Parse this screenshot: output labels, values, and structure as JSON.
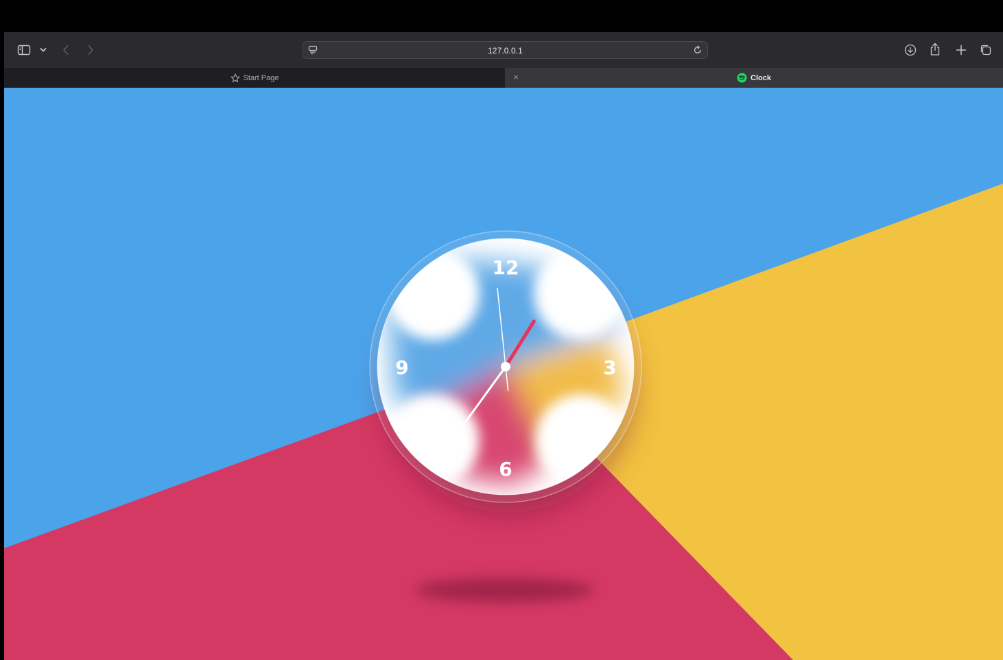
{
  "browser": {
    "url": "127.0.0.1",
    "tabs": [
      {
        "label": "Start Page",
        "icon": "star-icon",
        "active": false
      },
      {
        "label": "Clock",
        "icon": "spotify-icon",
        "active": true
      }
    ],
    "tab_close_glyph": "×"
  },
  "clock": {
    "numerals": {
      "twelve": "12",
      "three": "3",
      "six": "6",
      "nine": "9"
    },
    "time": {
      "hour": 12,
      "minute": 35,
      "second": 59
    },
    "colors": {
      "blue": "#4ba3ea",
      "red": "#d43963",
      "yellow": "#f2c241",
      "second_hand": "#e8325e",
      "hands": "#ffffff"
    }
  }
}
